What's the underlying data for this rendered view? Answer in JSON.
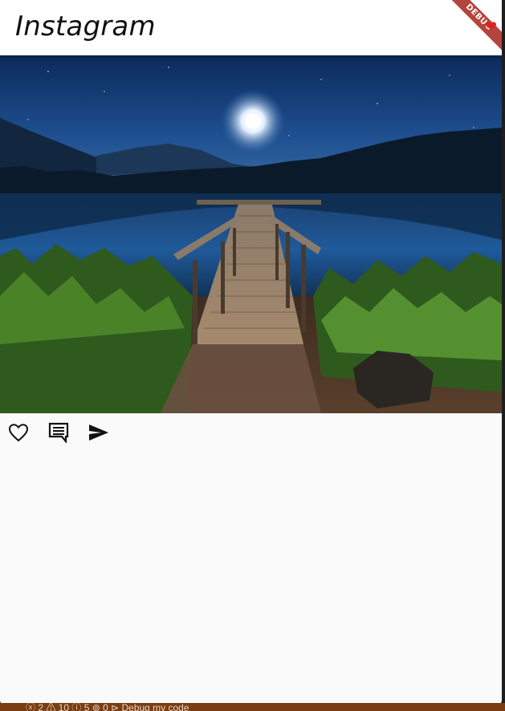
{
  "app_bar": {
    "title": "Instagram"
  },
  "debug_banner": {
    "label": "DEBUG"
  },
  "post": {
    "image": {
      "description_icon": "landscape-photo"
    },
    "actions": [
      {
        "icon": "heart-outline-icon"
      },
      {
        "icon": "comment-icon"
      },
      {
        "icon": "send-icon"
      }
    ]
  },
  "ide": {
    "status_text": "ⓧ 2  ⚠ 10 ⓘ 5     ⊚ 0      ⊳  Debug my code"
  },
  "colors": {
    "app_bar_bg": "#ffffff",
    "body_bg": "#fafafa",
    "debug_ribbon": "#b5443c",
    "icon": "#111111"
  }
}
